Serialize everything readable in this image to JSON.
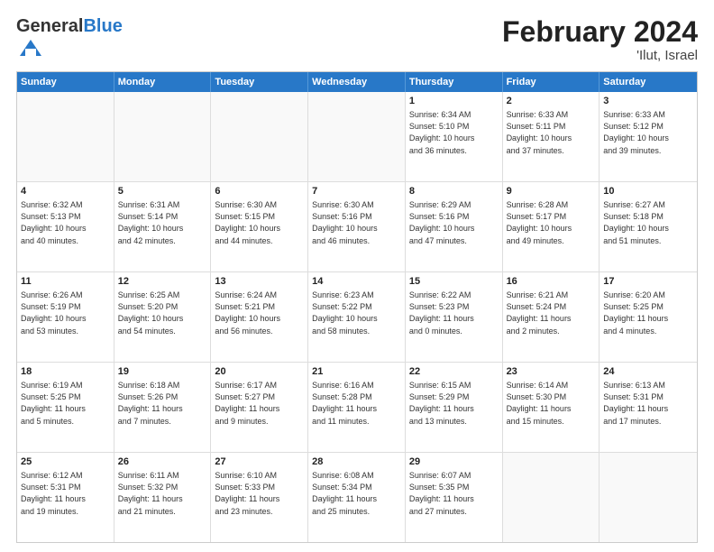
{
  "logo": {
    "general": "General",
    "blue": "Blue"
  },
  "title": {
    "month": "February 2024",
    "location": "'Ilut, Israel"
  },
  "header": {
    "days": [
      "Sunday",
      "Monday",
      "Tuesday",
      "Wednesday",
      "Thursday",
      "Friday",
      "Saturday"
    ]
  },
  "weeks": [
    [
      {
        "day": "",
        "info": ""
      },
      {
        "day": "",
        "info": ""
      },
      {
        "day": "",
        "info": ""
      },
      {
        "day": "",
        "info": ""
      },
      {
        "day": "1",
        "info": "Sunrise: 6:34 AM\nSunset: 5:10 PM\nDaylight: 10 hours\nand 36 minutes."
      },
      {
        "day": "2",
        "info": "Sunrise: 6:33 AM\nSunset: 5:11 PM\nDaylight: 10 hours\nand 37 minutes."
      },
      {
        "day": "3",
        "info": "Sunrise: 6:33 AM\nSunset: 5:12 PM\nDaylight: 10 hours\nand 39 minutes."
      }
    ],
    [
      {
        "day": "4",
        "info": "Sunrise: 6:32 AM\nSunset: 5:13 PM\nDaylight: 10 hours\nand 40 minutes."
      },
      {
        "day": "5",
        "info": "Sunrise: 6:31 AM\nSunset: 5:14 PM\nDaylight: 10 hours\nand 42 minutes."
      },
      {
        "day": "6",
        "info": "Sunrise: 6:30 AM\nSunset: 5:15 PM\nDaylight: 10 hours\nand 44 minutes."
      },
      {
        "day": "7",
        "info": "Sunrise: 6:30 AM\nSunset: 5:16 PM\nDaylight: 10 hours\nand 46 minutes."
      },
      {
        "day": "8",
        "info": "Sunrise: 6:29 AM\nSunset: 5:16 PM\nDaylight: 10 hours\nand 47 minutes."
      },
      {
        "day": "9",
        "info": "Sunrise: 6:28 AM\nSunset: 5:17 PM\nDaylight: 10 hours\nand 49 minutes."
      },
      {
        "day": "10",
        "info": "Sunrise: 6:27 AM\nSunset: 5:18 PM\nDaylight: 10 hours\nand 51 minutes."
      }
    ],
    [
      {
        "day": "11",
        "info": "Sunrise: 6:26 AM\nSunset: 5:19 PM\nDaylight: 10 hours\nand 53 minutes."
      },
      {
        "day": "12",
        "info": "Sunrise: 6:25 AM\nSunset: 5:20 PM\nDaylight: 10 hours\nand 54 minutes."
      },
      {
        "day": "13",
        "info": "Sunrise: 6:24 AM\nSunset: 5:21 PM\nDaylight: 10 hours\nand 56 minutes."
      },
      {
        "day": "14",
        "info": "Sunrise: 6:23 AM\nSunset: 5:22 PM\nDaylight: 10 hours\nand 58 minutes."
      },
      {
        "day": "15",
        "info": "Sunrise: 6:22 AM\nSunset: 5:23 PM\nDaylight: 11 hours\nand 0 minutes."
      },
      {
        "day": "16",
        "info": "Sunrise: 6:21 AM\nSunset: 5:24 PM\nDaylight: 11 hours\nand 2 minutes."
      },
      {
        "day": "17",
        "info": "Sunrise: 6:20 AM\nSunset: 5:25 PM\nDaylight: 11 hours\nand 4 minutes."
      }
    ],
    [
      {
        "day": "18",
        "info": "Sunrise: 6:19 AM\nSunset: 5:25 PM\nDaylight: 11 hours\nand 5 minutes."
      },
      {
        "day": "19",
        "info": "Sunrise: 6:18 AM\nSunset: 5:26 PM\nDaylight: 11 hours\nand 7 minutes."
      },
      {
        "day": "20",
        "info": "Sunrise: 6:17 AM\nSunset: 5:27 PM\nDaylight: 11 hours\nand 9 minutes."
      },
      {
        "day": "21",
        "info": "Sunrise: 6:16 AM\nSunset: 5:28 PM\nDaylight: 11 hours\nand 11 minutes."
      },
      {
        "day": "22",
        "info": "Sunrise: 6:15 AM\nSunset: 5:29 PM\nDaylight: 11 hours\nand 13 minutes."
      },
      {
        "day": "23",
        "info": "Sunrise: 6:14 AM\nSunset: 5:30 PM\nDaylight: 11 hours\nand 15 minutes."
      },
      {
        "day": "24",
        "info": "Sunrise: 6:13 AM\nSunset: 5:31 PM\nDaylight: 11 hours\nand 17 minutes."
      }
    ],
    [
      {
        "day": "25",
        "info": "Sunrise: 6:12 AM\nSunset: 5:31 PM\nDaylight: 11 hours\nand 19 minutes."
      },
      {
        "day": "26",
        "info": "Sunrise: 6:11 AM\nSunset: 5:32 PM\nDaylight: 11 hours\nand 21 minutes."
      },
      {
        "day": "27",
        "info": "Sunrise: 6:10 AM\nSunset: 5:33 PM\nDaylight: 11 hours\nand 23 minutes."
      },
      {
        "day": "28",
        "info": "Sunrise: 6:08 AM\nSunset: 5:34 PM\nDaylight: 11 hours\nand 25 minutes."
      },
      {
        "day": "29",
        "info": "Sunrise: 6:07 AM\nSunset: 5:35 PM\nDaylight: 11 hours\nand 27 minutes."
      },
      {
        "day": "",
        "info": ""
      },
      {
        "day": "",
        "info": ""
      }
    ]
  ]
}
